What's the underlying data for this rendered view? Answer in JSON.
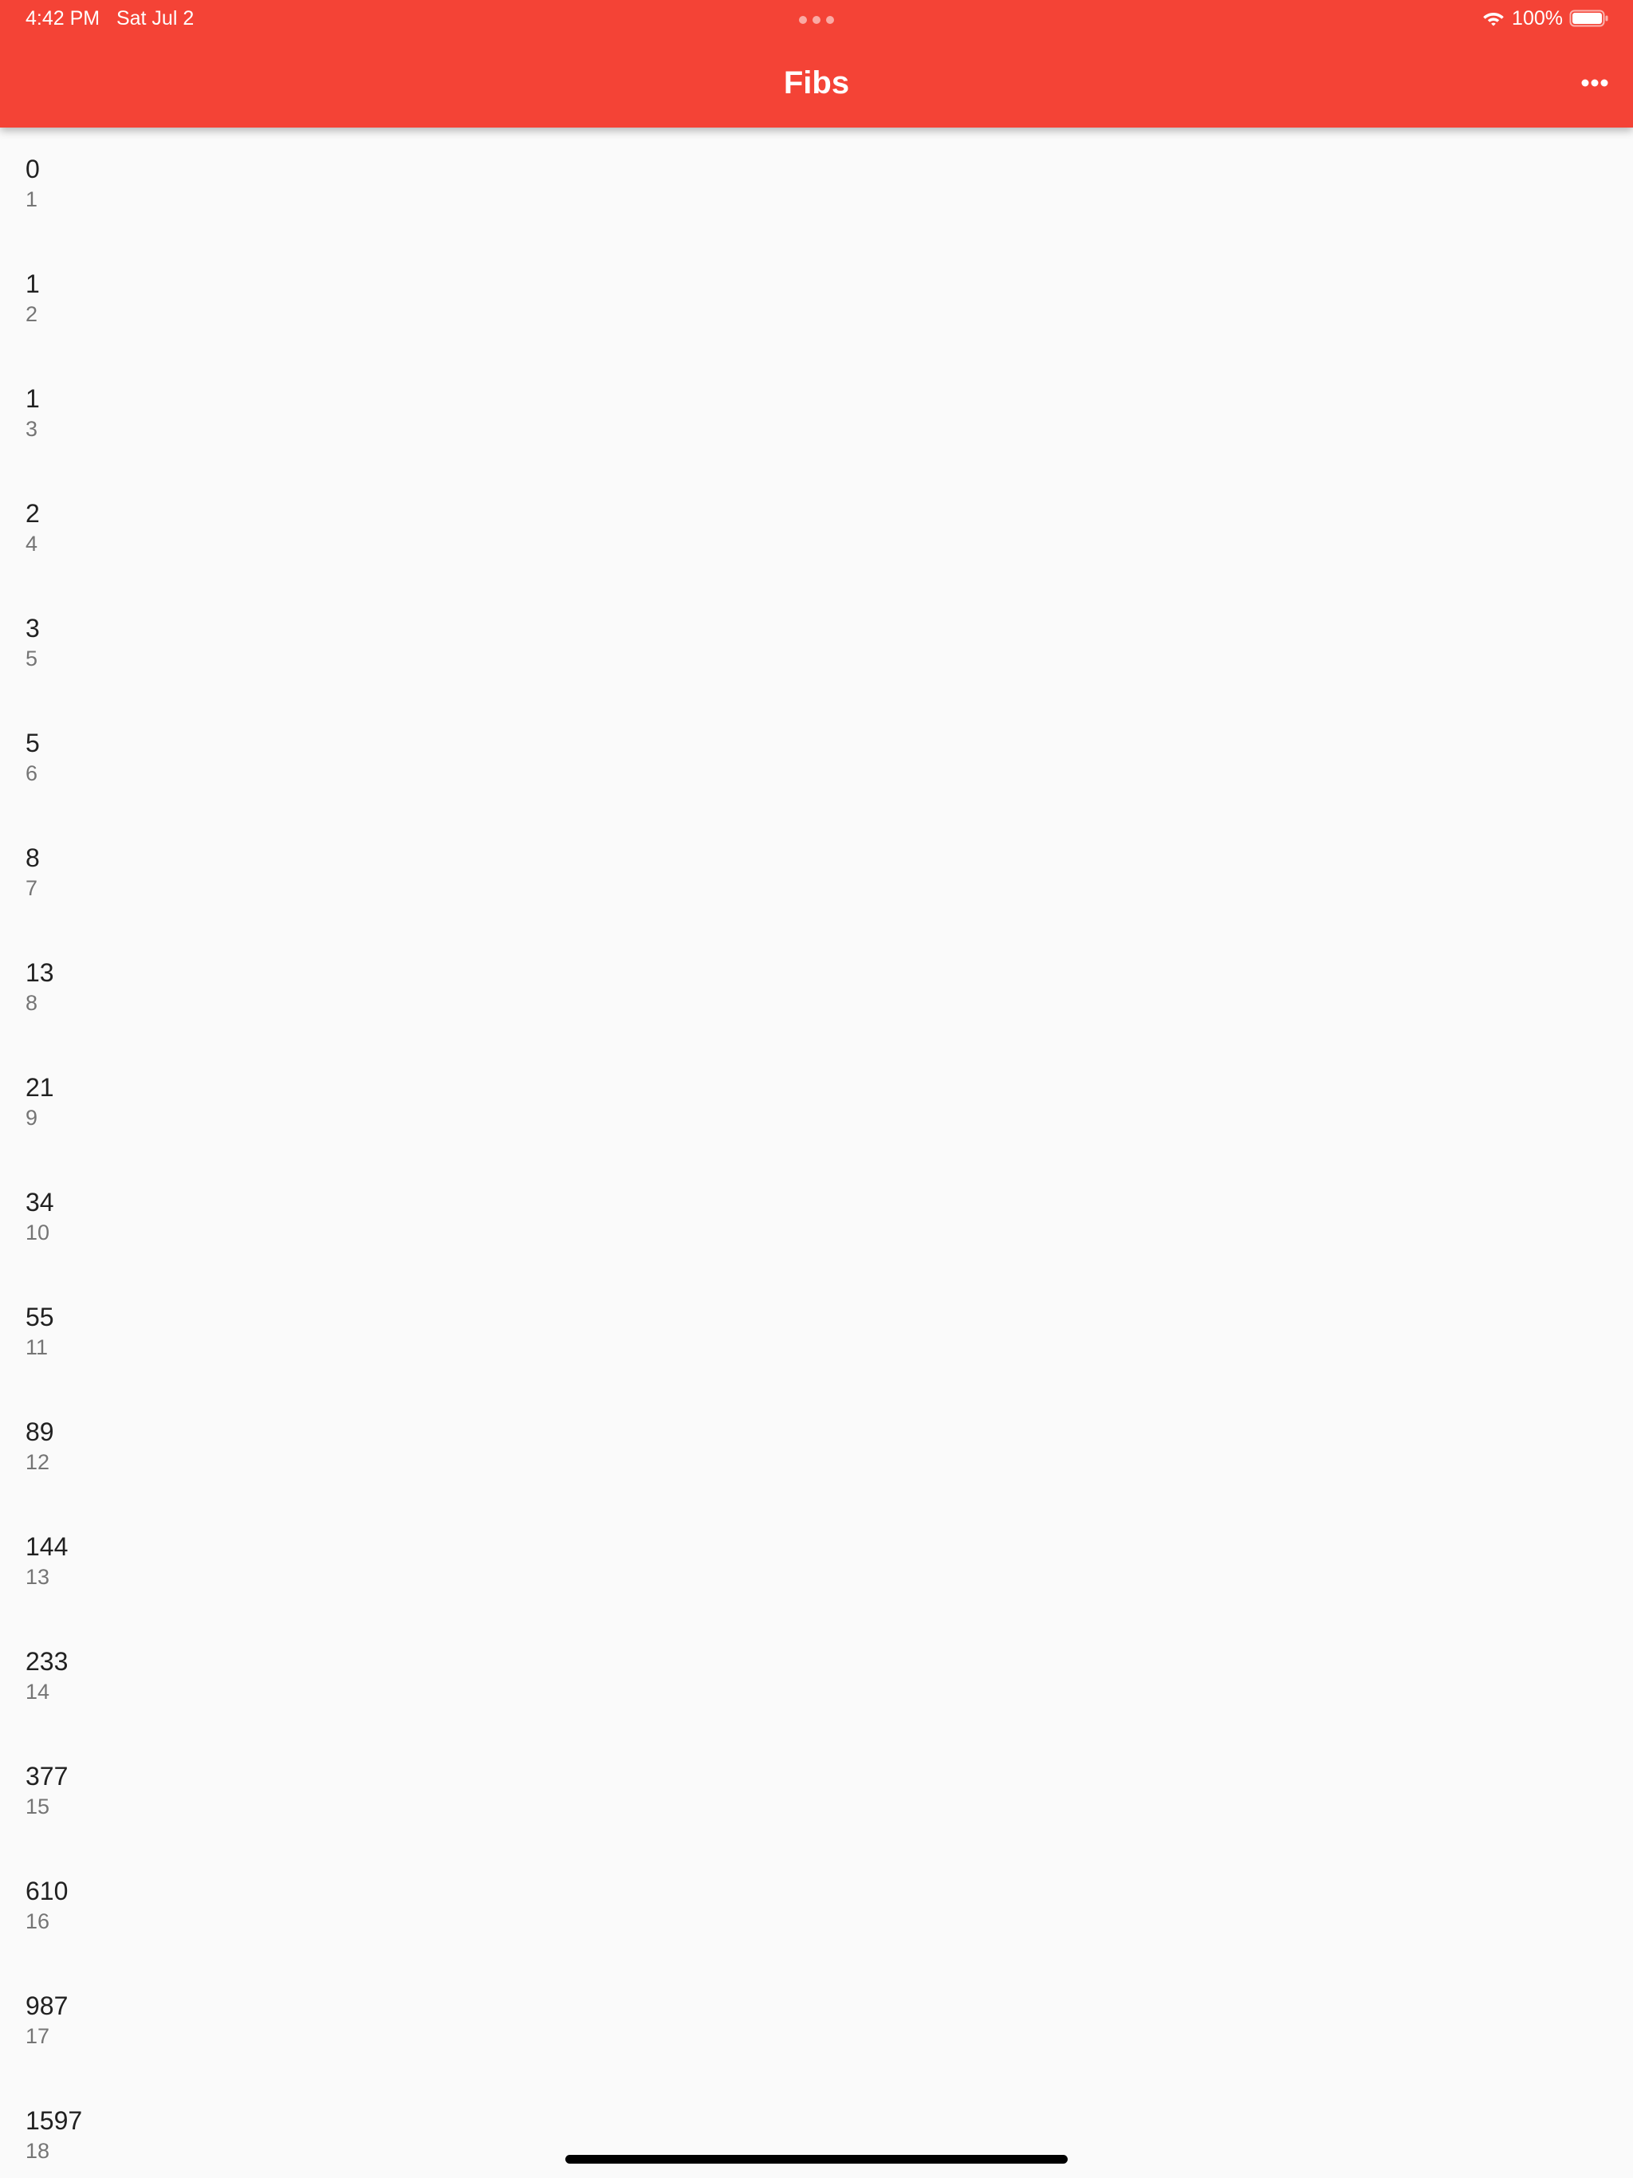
{
  "status_bar": {
    "time_date": "4:42 PM   Sat Jul 2",
    "battery": "100%"
  },
  "app_bar": {
    "title": "Fibs",
    "more_icon": "more-horizontal-icon",
    "background": "#f44336"
  },
  "list": {
    "items": [
      {
        "title": "0",
        "subtitle": "1"
      },
      {
        "title": "1",
        "subtitle": "2"
      },
      {
        "title": "1",
        "subtitle": "3"
      },
      {
        "title": "2",
        "subtitle": "4"
      },
      {
        "title": "3",
        "subtitle": "5"
      },
      {
        "title": "5",
        "subtitle": "6"
      },
      {
        "title": "8",
        "subtitle": "7"
      },
      {
        "title": "13",
        "subtitle": "8"
      },
      {
        "title": "21",
        "subtitle": "9"
      },
      {
        "title": "34",
        "subtitle": "10"
      },
      {
        "title": "55",
        "subtitle": "11"
      },
      {
        "title": "89",
        "subtitle": "12"
      },
      {
        "title": "144",
        "subtitle": "13"
      },
      {
        "title": "233",
        "subtitle": "14"
      },
      {
        "title": "377",
        "subtitle": "15"
      },
      {
        "title": "610",
        "subtitle": "16"
      },
      {
        "title": "987",
        "subtitle": "17"
      },
      {
        "title": "1597",
        "subtitle": "18"
      }
    ]
  }
}
